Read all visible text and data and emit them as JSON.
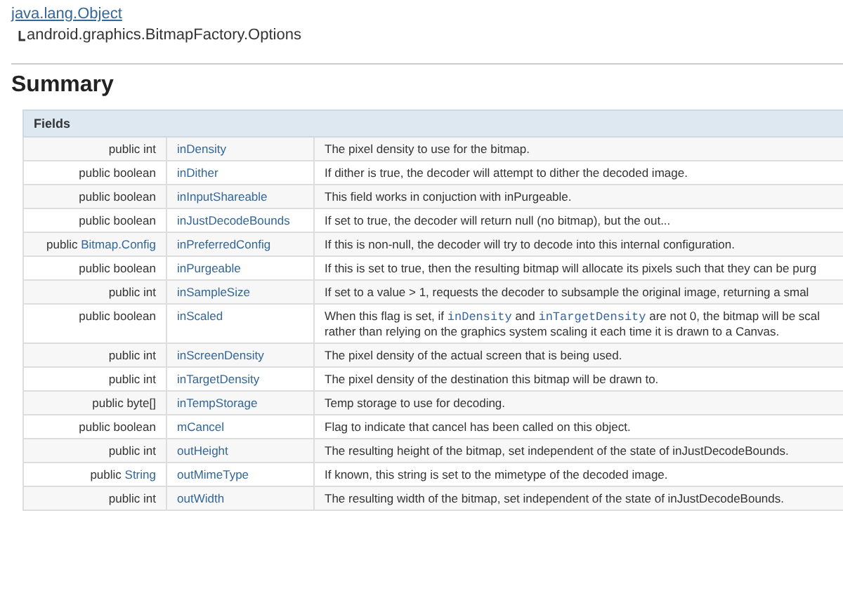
{
  "inheritance": {
    "parent": "java.lang.Object",
    "child": "android.graphics.BitmapFactory.Options"
  },
  "summary": {
    "title": "Summary",
    "table": {
      "header": "Fields",
      "rows": [
        {
          "modifier": "public",
          "type": "int",
          "type_linked": false,
          "name": "inDensity",
          "description": [
            {
              "kind": "text",
              "text": "The pixel density to use for the bitmap."
            }
          ]
        },
        {
          "modifier": "public",
          "type": "boolean",
          "type_linked": false,
          "name": "inDither",
          "description": [
            {
              "kind": "text",
              "text": "If dither is true, the decoder will attempt to dither the decoded image."
            }
          ]
        },
        {
          "modifier": "public",
          "type": "boolean",
          "type_linked": false,
          "name": "inInputShareable",
          "description": [
            {
              "kind": "text",
              "text": "This field works in conjuction with inPurgeable."
            }
          ]
        },
        {
          "modifier": "public",
          "type": "boolean",
          "type_linked": false,
          "name": "inJustDecodeBounds",
          "description": [
            {
              "kind": "text",
              "text": "If set to true, the decoder will return null (no bitmap), but the out..."
            }
          ]
        },
        {
          "modifier": "public",
          "type": "Bitmap.Config",
          "type_linked": true,
          "name": "inPreferredConfig",
          "description": [
            {
              "kind": "text",
              "text": "If this is non-null, the decoder will try to decode into this internal configuration."
            }
          ]
        },
        {
          "modifier": "public",
          "type": "boolean",
          "type_linked": false,
          "name": "inPurgeable",
          "description": [
            {
              "kind": "text",
              "text": "If this is set to true, then the resulting bitmap will allocate its pixels such that they can be purg"
            }
          ]
        },
        {
          "modifier": "public",
          "type": "int",
          "type_linked": false,
          "name": "inSampleSize",
          "description": [
            {
              "kind": "text",
              "text": "If set to a value > 1, requests the decoder to subsample the original image, returning a smal"
            }
          ]
        },
        {
          "modifier": "public",
          "type": "boolean",
          "type_linked": false,
          "name": "inScaled",
          "description": [
            {
              "kind": "text",
              "text": "When this flag is set, if "
            },
            {
              "kind": "code",
              "text": "inDensity"
            },
            {
              "kind": "text",
              "text": " and "
            },
            {
              "kind": "code",
              "text": "inTargetDensity"
            },
            {
              "kind": "text",
              "text": " are not 0, the bitmap will be scal"
            },
            {
              "kind": "break"
            },
            {
              "kind": "text",
              "text": "rather than relying on the graphics system scaling it each time it is drawn to a Canvas."
            }
          ]
        },
        {
          "modifier": "public",
          "type": "int",
          "type_linked": false,
          "name": "inScreenDensity",
          "description": [
            {
              "kind": "text",
              "text": "The pixel density of the actual screen that is being used."
            }
          ]
        },
        {
          "modifier": "public",
          "type": "int",
          "type_linked": false,
          "name": "inTargetDensity",
          "description": [
            {
              "kind": "text",
              "text": "The pixel density of the destination this bitmap will be drawn to."
            }
          ]
        },
        {
          "modifier": "public",
          "type": "byte[]",
          "type_linked": false,
          "name": "inTempStorage",
          "description": [
            {
              "kind": "text",
              "text": "Temp storage to use for decoding."
            }
          ]
        },
        {
          "modifier": "public",
          "type": "boolean",
          "type_linked": false,
          "name": "mCancel",
          "description": [
            {
              "kind": "text",
              "text": "Flag to indicate that cancel has been called on this object."
            }
          ]
        },
        {
          "modifier": "public",
          "type": "int",
          "type_linked": false,
          "name": "outHeight",
          "description": [
            {
              "kind": "text",
              "text": "The resulting height of the bitmap, set independent of the state of inJustDecodeBounds."
            }
          ]
        },
        {
          "modifier": "public",
          "type": "String",
          "type_linked": true,
          "name": "outMimeType",
          "description": [
            {
              "kind": "text",
              "text": "If known, this string is set to the mimetype of the decoded image."
            }
          ]
        },
        {
          "modifier": "public",
          "type": "int",
          "type_linked": false,
          "name": "outWidth",
          "description": [
            {
              "kind": "text",
              "text": "The resulting width of the bitmap, set independent of the state of inJustDecodeBounds."
            }
          ]
        }
      ]
    }
  }
}
